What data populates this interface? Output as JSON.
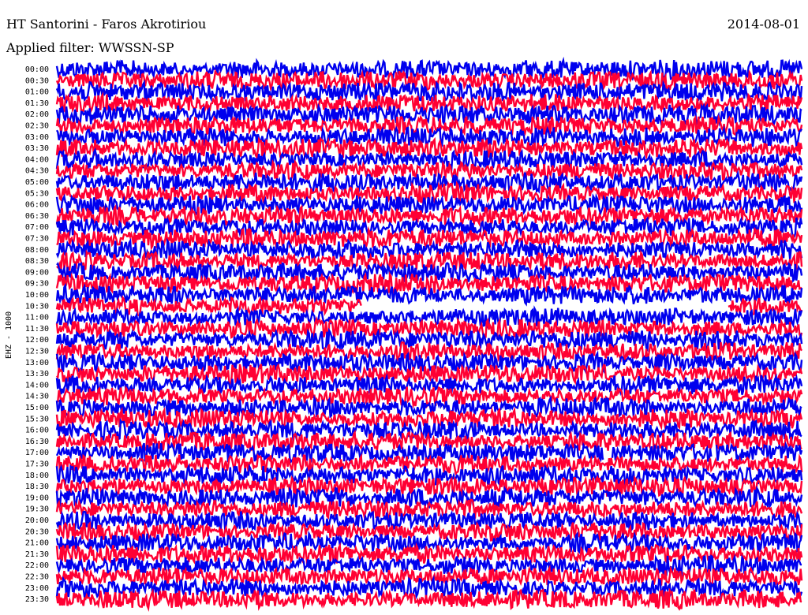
{
  "header": {
    "title": "HT Santorini - Faros Akrotiriou",
    "date": "2014-08-01",
    "filter": "Applied filter: WWSSN-SP"
  },
  "chart_data": {
    "type": "line",
    "title": "HT Santorini - Faros Akrotiriou",
    "subtitle": "Applied filter: WWSSN-SP",
    "date": "2014-08-01",
    "channel_label": "EHZ - 1000",
    "time_labels": [
      "00:00",
      "00:30",
      "01:00",
      "01:30",
      "02:00",
      "02:30",
      "03:00",
      "03:30",
      "04:00",
      "04:30",
      "05:00",
      "05:30",
      "06:00",
      "06:30",
      "07:00",
      "07:30",
      "08:00",
      "08:30",
      "09:00",
      "09:30",
      "10:00",
      "10:30",
      "11:00",
      "11:30",
      "12:00",
      "12:30",
      "13:00",
      "13:30",
      "14:00",
      "14:30",
      "15:00",
      "15:30",
      "16:00",
      "16:30",
      "17:00",
      "17:30",
      "18:00",
      "18:30",
      "19:00",
      "19:30",
      "20:00",
      "20:30",
      "21:00",
      "21:30",
      "22:00",
      "22:30",
      "23:00",
      "23:30"
    ],
    "trace_colors": [
      "#0000ee",
      "#ff0033"
    ],
    "data_gaps": [
      {
        "trace": "10:30",
        "start_fraction": 0.41,
        "end_fraction": 0.9
      },
      {
        "trace": "17:00",
        "start_fraction": 0.735,
        "end_fraction": 0.745
      },
      {
        "trace": "17:00",
        "start_fraction": 0.88,
        "end_fraction": 0.885
      }
    ]
  }
}
